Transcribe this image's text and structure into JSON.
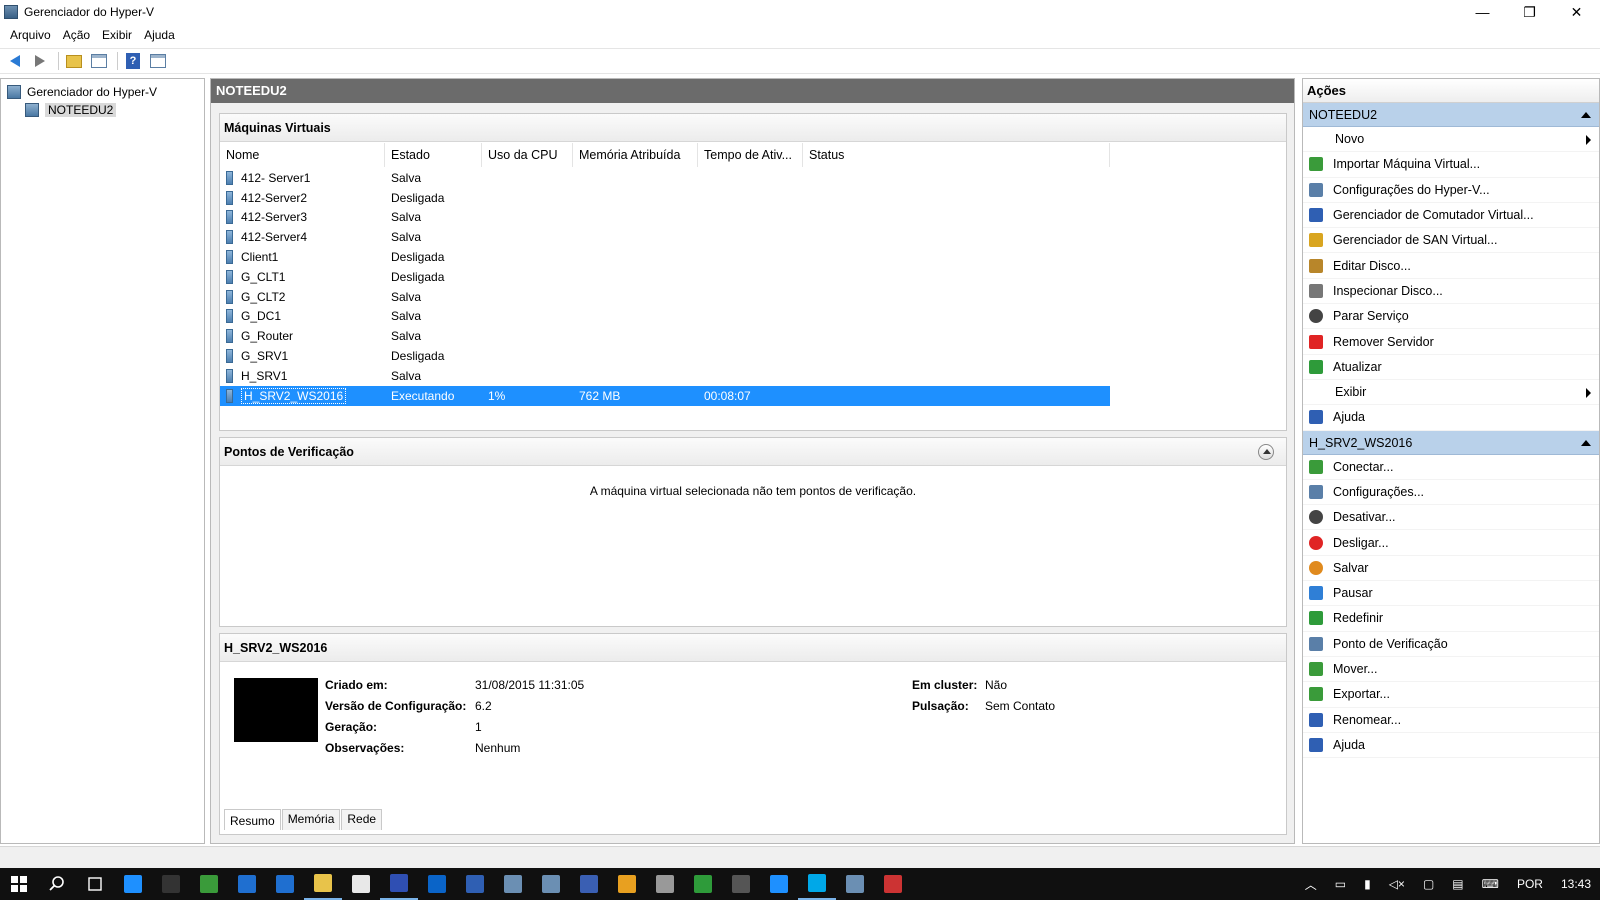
{
  "window": {
    "title": "Gerenciador do Hyper-V",
    "minimize": "—",
    "restore": "❐",
    "close": "✕"
  },
  "menu": [
    "Arquivo",
    "Ação",
    "Exibir",
    "Ajuda"
  ],
  "tree": {
    "root": "Gerenciador do Hyper-V",
    "server": "NOTEEDU2"
  },
  "center": {
    "header": "NOTEEDU2",
    "vms_title": "Máquinas Virtuais",
    "columns": [
      "Nome",
      "Estado",
      "Uso da CPU",
      "Memória Atribuída",
      "Tempo de Ativ...",
      "Status"
    ],
    "vms": [
      {
        "name": "412- Server1",
        "state": "Salva",
        "cpu": "",
        "mem": "",
        "uptime": "",
        "status": ""
      },
      {
        "name": "412-Server2",
        "state": "Desligada",
        "cpu": "",
        "mem": "",
        "uptime": "",
        "status": ""
      },
      {
        "name": "412-Server3",
        "state": "Salva",
        "cpu": "",
        "mem": "",
        "uptime": "",
        "status": ""
      },
      {
        "name": "412-Server4",
        "state": "Salva",
        "cpu": "",
        "mem": "",
        "uptime": "",
        "status": ""
      },
      {
        "name": "Client1",
        "state": "Desligada",
        "cpu": "",
        "mem": "",
        "uptime": "",
        "status": ""
      },
      {
        "name": "G_CLT1",
        "state": "Desligada",
        "cpu": "",
        "mem": "",
        "uptime": "",
        "status": ""
      },
      {
        "name": "G_CLT2",
        "state": "Salva",
        "cpu": "",
        "mem": "",
        "uptime": "",
        "status": ""
      },
      {
        "name": "G_DC1",
        "state": "Salva",
        "cpu": "",
        "mem": "",
        "uptime": "",
        "status": ""
      },
      {
        "name": "G_Router",
        "state": "Salva",
        "cpu": "",
        "mem": "",
        "uptime": "",
        "status": ""
      },
      {
        "name": "G_SRV1",
        "state": "Desligada",
        "cpu": "",
        "mem": "",
        "uptime": "",
        "status": ""
      },
      {
        "name": "H_SRV1",
        "state": "Salva",
        "cpu": "",
        "mem": "",
        "uptime": "",
        "status": ""
      },
      {
        "name": "H_SRV2_WS2016",
        "state": "Executando",
        "cpu": "1%",
        "mem": "762 MB",
        "uptime": "00:08:07",
        "status": "",
        "selected": true
      }
    ],
    "checkpoints_title": "Pontos de Verificação",
    "checkpoints_empty": "A máquina virtual selecionada não tem pontos de verificação.",
    "details_title": "H_SRV2_WS2016",
    "details": {
      "created_label": "Criado em:",
      "created": "31/08/2015 11:31:05",
      "config_label": "Versão de Configuração:",
      "config": "6.2",
      "gen_label": "Geração:",
      "gen": "1",
      "notes_label": "Observações:",
      "notes": "Nenhum",
      "cluster_label": "Em cluster:",
      "cluster": "Não",
      "heartbeat_label": "Pulsação:",
      "heartbeat": "Sem Contato"
    },
    "tabs": [
      "Resumo",
      "Memória",
      "Rede"
    ]
  },
  "actions": {
    "title": "Ações",
    "group1": "NOTEEDU2",
    "group1_items": [
      {
        "label": "Novo",
        "icon": "none",
        "sub": true
      },
      {
        "label": "Importar Máquina Virtual...",
        "icon": "import-icon",
        "color": "#3a9b3a"
      },
      {
        "label": "Configurações do Hyper-V...",
        "icon": "settings-icon",
        "color": "#5a7fa8"
      },
      {
        "label": "Gerenciador de Comutador Virtual...",
        "icon": "switch-icon",
        "color": "#2f5fb3"
      },
      {
        "label": "Gerenciador de SAN Virtual...",
        "icon": "san-icon",
        "color": "#d9a520"
      },
      {
        "label": "Editar Disco...",
        "icon": "edit-disk-icon",
        "color": "#b8862a"
      },
      {
        "label": "Inspecionar Disco...",
        "icon": "inspect-disk-icon",
        "color": "#777777"
      },
      {
        "label": "Parar Serviço",
        "icon": "stop-icon",
        "color": "#444444"
      },
      {
        "label": "Remover Servidor",
        "icon": "remove-icon",
        "color": "#e02424"
      },
      {
        "label": "Atualizar",
        "icon": "refresh-icon",
        "color": "#2e9b3a"
      },
      {
        "label": "Exibir",
        "icon": "none",
        "sub": true
      },
      {
        "label": "Ajuda",
        "icon": "help-icon",
        "color": "#2f5fb3"
      }
    ],
    "group2": "H_SRV2_WS2016",
    "group2_items": [
      {
        "label": "Conectar...",
        "icon": "connect-icon",
        "color": "#3a9b3a"
      },
      {
        "label": "Configurações...",
        "icon": "settings-icon",
        "color": "#5a7fa8"
      },
      {
        "label": "Desativar...",
        "icon": "turn-off-icon",
        "color": "#444444"
      },
      {
        "label": "Desligar...",
        "icon": "shutdown-icon",
        "color": "#e02424"
      },
      {
        "label": "Salvar",
        "icon": "save-icon",
        "color": "#e08a1e"
      },
      {
        "label": "Pausar",
        "icon": "pause-icon",
        "color": "#2f7fd6"
      },
      {
        "label": "Redefinir",
        "icon": "reset-icon",
        "color": "#2e9b3a"
      },
      {
        "label": "Ponto de Verificação",
        "icon": "checkpoint-icon",
        "color": "#5a7fa8"
      },
      {
        "label": "Mover...",
        "icon": "move-icon",
        "color": "#3a9b3a"
      },
      {
        "label": "Exportar...",
        "icon": "export-icon",
        "color": "#3a9b3a"
      },
      {
        "label": "Renomear...",
        "icon": "rename-icon",
        "color": "#2f5fb3"
      },
      {
        "label": "Ajuda",
        "icon": "help-icon",
        "color": "#2f5fb3"
      }
    ]
  },
  "taskbar": {
    "language": "POR",
    "time": "13:43",
    "apps": [
      "#1e90ff",
      "#333",
      "#3a9b3a",
      "#1f6fd0",
      "#1f6fd0",
      "#e8c34a",
      "#e8e8e8",
      "#2f4fb3",
      "#0a64c8",
      "#2f5fb3",
      "#6b8fb3",
      "#6b8fb3",
      "#3a5fb3",
      "#e8a020",
      "#999",
      "#2e9b3a",
      "#555",
      "#1e90ff",
      "#00a8e8",
      "#6b8fb3",
      "#c33"
    ]
  }
}
